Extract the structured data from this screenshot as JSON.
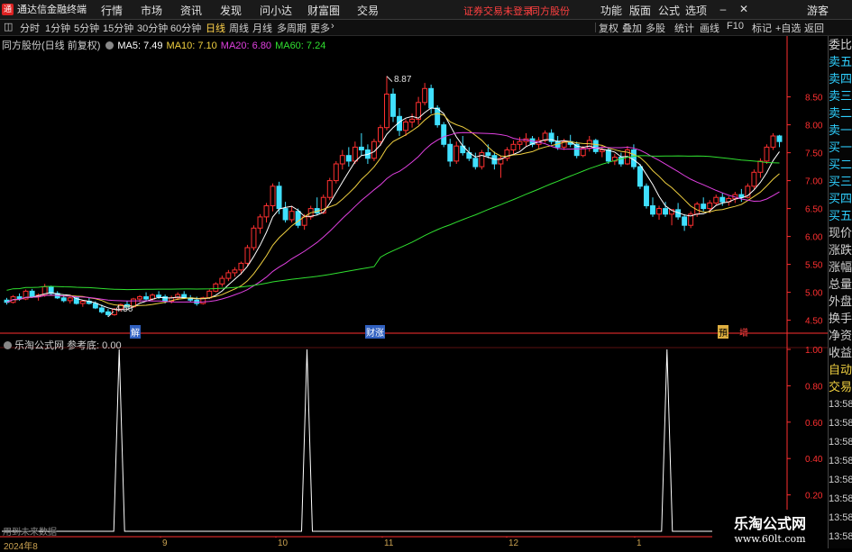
{
  "titlebar": {
    "brand": "通达信金融终端",
    "menus": [
      "行情",
      "市场",
      "资讯",
      "发现",
      "问小达",
      "财富圈",
      "交易"
    ],
    "warning": "证券交易未登录",
    "stock_name": "同方股份",
    "right_menus": [
      "功能",
      "版面",
      "公式",
      "选项"
    ],
    "user": "游客"
  },
  "toolbar": {
    "periods": [
      "分时",
      "1分钟",
      "5分钟",
      "15分钟",
      "30分钟",
      "60分钟",
      "日线",
      "周线",
      "月线",
      "多周期",
      "更多"
    ],
    "active_period": "日线",
    "right_buttons": [
      "复权",
      "叠加",
      "多股",
      "统计",
      "画线",
      "F10",
      "标记",
      "+自选",
      "返回"
    ]
  },
  "legend": {
    "name": "同方股份(日线 前复权)",
    "ma5": "MA5: 7.49",
    "ma10": "MA10: 7.10",
    "ma20": "MA20: 6.80",
    "ma60": "MA60: 7.24"
  },
  "colors": {
    "ma5": "#ffffff",
    "ma10": "#f0d040",
    "ma20": "#e040e0",
    "ma60": "#30e030",
    "up": "#ff3030",
    "down": "#40e0ff",
    "axis": "#ff3030"
  },
  "annotations": {
    "high": "8.87",
    "low": "4.56",
    "marker_jie": "解",
    "marker_caizhang": "财涨",
    "marker_jiang": "預",
    "marker_zeng": "增"
  },
  "sub": {
    "title": "乐淘公式网",
    "indicator": "参考底: 0.00",
    "no_future": "用到未来数据"
  },
  "right_panel": {
    "quote_labels": [
      "委比",
      "卖五",
      "卖四",
      "卖三",
      "卖二",
      "卖一",
      "买一",
      "买二",
      "买三",
      "买四",
      "买五",
      "现价",
      "涨跌",
      "涨幅",
      "总量",
      "外盘",
      "换手",
      "净资",
      "收益"
    ],
    "auto_labels": [
      "自动",
      "交易"
    ],
    "times": [
      "13:58",
      "13:58",
      "13:58",
      "13:58",
      "13:58",
      "13:58",
      "13:58",
      "13:58",
      "13:58"
    ]
  },
  "price_axis": [
    "8.50",
    "8.00",
    "7.50",
    "7.00",
    "6.50",
    "6.00",
    "5.50",
    "5.00",
    "4.50"
  ],
  "sub_axis": [
    "1.00",
    "0.80",
    "0.60",
    "0.40",
    "0.20"
  ],
  "date_labels": [
    "2024年8",
    "9",
    "10",
    "11",
    "12",
    "1"
  ],
  "watermark": {
    "line1": "乐淘公式网",
    "line2": "www.60lt.com"
  },
  "chart_data": [
    {
      "type": "candlestick",
      "title": "同方股份(日线 前复权)",
      "ylim": [
        4.3,
        9.3
      ],
      "yticks": [
        4.5,
        5.0,
        5.5,
        6.0,
        6.5,
        7.0,
        7.5,
        8.0,
        8.5
      ],
      "x_labels": [
        "2024年8",
        "9",
        "10",
        "11",
        "12",
        "1"
      ],
      "candles": [
        [
          4.86,
          4.9,
          4.78,
          4.82
        ],
        [
          4.82,
          4.95,
          4.8,
          4.92
        ],
        [
          4.92,
          4.98,
          4.85,
          4.88
        ],
        [
          4.88,
          5.05,
          4.86,
          5.02
        ],
        [
          5.02,
          5.06,
          4.9,
          4.92
        ],
        [
          4.92,
          4.98,
          4.85,
          4.95
        ],
        [
          4.95,
          5.15,
          4.92,
          5.1
        ],
        [
          5.1,
          5.12,
          4.95,
          4.98
        ],
        [
          4.98,
          5.02,
          4.88,
          4.9
        ],
        [
          4.9,
          4.95,
          4.82,
          4.85
        ],
        [
          4.85,
          4.92,
          4.8,
          4.9
        ],
        [
          4.9,
          4.92,
          4.78,
          4.8
        ],
        [
          4.8,
          4.86,
          4.74,
          4.84
        ],
        [
          4.84,
          4.9,
          4.78,
          4.8
        ],
        [
          4.8,
          4.84,
          4.7,
          4.72
        ],
        [
          4.72,
          4.78,
          4.62,
          4.65
        ],
        [
          4.65,
          4.7,
          4.56,
          4.6
        ],
        [
          4.6,
          4.72,
          4.58,
          4.7
        ],
        [
          4.7,
          4.8,
          4.66,
          4.78
        ],
        [
          4.78,
          4.85,
          4.72,
          4.74
        ],
        [
          4.74,
          4.9,
          4.72,
          4.88
        ],
        [
          4.88,
          4.95,
          4.82,
          4.92
        ],
        [
          4.92,
          5.0,
          4.85,
          4.88
        ],
        [
          4.88,
          4.98,
          4.84,
          4.95
        ],
        [
          4.95,
          5.02,
          4.88,
          4.92
        ],
        [
          4.92,
          4.96,
          4.8,
          4.84
        ],
        [
          4.84,
          4.94,
          4.8,
          4.9
        ],
        [
          4.9,
          5.0,
          4.86,
          4.96
        ],
        [
          4.96,
          5.02,
          4.88,
          4.9
        ],
        [
          4.9,
          4.95,
          4.82,
          4.86
        ],
        [
          4.86,
          4.92,
          4.76,
          4.8
        ],
        [
          4.8,
          4.92,
          4.78,
          4.9
        ],
        [
          4.9,
          5.05,
          4.88,
          5.02
        ],
        [
          5.02,
          5.18,
          5.0,
          5.15
        ],
        [
          5.15,
          5.3,
          5.1,
          5.25
        ],
        [
          5.25,
          5.4,
          5.2,
          5.35
        ],
        [
          5.35,
          5.45,
          5.28,
          5.4
        ],
        [
          5.4,
          5.55,
          5.32,
          5.52
        ],
        [
          5.52,
          5.85,
          5.48,
          5.8
        ],
        [
          5.8,
          6.2,
          5.75,
          6.15
        ],
        [
          6.15,
          6.4,
          6.05,
          6.35
        ],
        [
          6.35,
          6.6,
          6.25,
          6.55
        ],
        [
          6.55,
          6.95,
          6.45,
          6.9
        ],
        [
          6.9,
          6.98,
          6.4,
          6.5
        ],
        [
          6.5,
          6.62,
          6.25,
          6.3
        ],
        [
          6.3,
          6.55,
          6.25,
          6.45
        ],
        [
          6.45,
          6.5,
          6.15,
          6.2
        ],
        [
          6.2,
          6.4,
          6.12,
          6.35
        ],
        [
          6.35,
          6.55,
          6.3,
          6.5
        ],
        [
          6.5,
          6.7,
          6.38,
          6.42
        ],
        [
          6.42,
          6.75,
          6.4,
          6.7
        ],
        [
          6.7,
          7.05,
          6.65,
          7.0
        ],
        [
          7.0,
          7.35,
          6.95,
          7.3
        ],
        [
          7.3,
          7.55,
          7.2,
          7.45
        ],
        [
          7.45,
          7.6,
          7.25,
          7.35
        ],
        [
          7.35,
          7.7,
          7.3,
          7.6
        ],
        [
          7.6,
          7.85,
          7.45,
          7.55
        ],
        [
          7.55,
          7.65,
          7.3,
          7.4
        ],
        [
          7.4,
          7.75,
          7.35,
          7.7
        ],
        [
          7.7,
          8.0,
          7.62,
          7.95
        ],
        [
          7.95,
          8.87,
          7.9,
          8.55
        ],
        [
          8.55,
          8.65,
          8.05,
          8.15
        ],
        [
          8.15,
          8.3,
          7.8,
          7.9
        ],
        [
          7.9,
          8.1,
          7.8,
          8.05
        ],
        [
          8.05,
          8.2,
          7.95,
          8.1
        ],
        [
          8.1,
          8.5,
          8.0,
          8.4
        ],
        [
          8.4,
          8.75,
          8.35,
          8.65
        ],
        [
          8.65,
          8.72,
          8.2,
          8.3
        ],
        [
          8.3,
          8.35,
          7.95,
          8.0
        ],
        [
          8.0,
          8.05,
          7.6,
          7.65
        ],
        [
          7.65,
          7.75,
          7.25,
          7.35
        ],
        [
          7.35,
          7.7,
          7.3,
          7.62
        ],
        [
          7.62,
          7.8,
          7.45,
          7.5
        ],
        [
          7.5,
          7.6,
          7.35,
          7.4
        ],
        [
          7.4,
          7.5,
          7.2,
          7.25
        ],
        [
          7.25,
          7.55,
          7.2,
          7.5
        ],
        [
          7.5,
          7.65,
          7.4,
          7.45
        ],
        [
          7.45,
          7.52,
          7.2,
          7.3
        ],
        [
          7.3,
          7.45,
          7.05,
          7.4
        ],
        [
          7.4,
          7.6,
          7.35,
          7.55
        ],
        [
          7.55,
          7.72,
          7.48,
          7.65
        ],
        [
          7.65,
          7.78,
          7.55,
          7.7
        ],
        [
          7.7,
          7.85,
          7.62,
          7.75
        ],
        [
          7.75,
          7.8,
          7.6,
          7.65
        ],
        [
          7.65,
          7.78,
          7.58,
          7.72
        ],
        [
          7.72,
          7.9,
          7.68,
          7.85
        ],
        [
          7.85,
          7.92,
          7.65,
          7.7
        ],
        [
          7.7,
          7.8,
          7.55,
          7.6
        ],
        [
          7.6,
          7.75,
          7.55,
          7.7
        ],
        [
          7.7,
          7.82,
          7.6,
          7.65
        ],
        [
          7.65,
          7.7,
          7.4,
          7.45
        ],
        [
          7.45,
          7.62,
          7.42,
          7.58
        ],
        [
          7.58,
          7.8,
          7.52,
          7.72
        ],
        [
          7.72,
          7.75,
          7.48,
          7.52
        ],
        [
          7.52,
          7.62,
          7.42,
          7.55
        ],
        [
          7.55,
          7.6,
          7.3,
          7.35
        ],
        [
          7.35,
          7.48,
          7.28,
          7.42
        ],
        [
          7.42,
          7.5,
          7.25,
          7.3
        ],
        [
          7.3,
          7.62,
          7.28,
          7.55
        ],
        [
          7.55,
          7.65,
          7.2,
          7.25
        ],
        [
          7.25,
          7.3,
          6.85,
          6.9
        ],
        [
          6.9,
          6.95,
          6.5,
          6.55
        ],
        [
          6.55,
          6.7,
          6.35,
          6.4
        ],
        [
          6.4,
          6.55,
          6.3,
          6.5
        ],
        [
          6.5,
          6.62,
          6.35,
          6.4
        ],
        [
          6.4,
          6.48,
          6.2,
          6.48
        ],
        [
          6.48,
          6.6,
          6.3,
          6.35
        ],
        [
          6.35,
          6.4,
          6.1,
          6.2
        ],
        [
          6.2,
          6.45,
          6.15,
          6.4
        ],
        [
          6.4,
          6.62,
          6.35,
          6.58
        ],
        [
          6.58,
          6.7,
          6.45,
          6.5
        ],
        [
          6.5,
          6.65,
          6.42,
          6.6
        ],
        [
          6.6,
          6.75,
          6.55,
          6.7
        ],
        [
          6.7,
          6.78,
          6.55,
          6.62
        ],
        [
          6.62,
          6.72,
          6.55,
          6.68
        ],
        [
          6.68,
          6.8,
          6.6,
          6.75
        ],
        [
          6.75,
          6.85,
          6.62,
          6.7
        ],
        [
          6.7,
          6.95,
          6.68,
          6.9
        ],
        [
          6.9,
          7.2,
          6.85,
          7.15
        ],
        [
          7.15,
          7.4,
          7.05,
          7.35
        ],
        [
          7.35,
          7.65,
          7.3,
          7.6
        ],
        [
          7.6,
          7.85,
          7.55,
          7.8
        ],
        [
          7.8,
          7.82,
          7.6,
          7.7
        ]
      ],
      "series": [
        {
          "name": "MA5",
          "color": "#ffffff"
        },
        {
          "name": "MA10",
          "color": "#f0d040"
        },
        {
          "name": "MA20",
          "color": "#e040e0"
        },
        {
          "name": "MA60",
          "color": "#30e030"
        }
      ],
      "high_label": "8.87",
      "low_label": "4.56"
    },
    {
      "type": "line",
      "title": "乐淘公式网 参考底",
      "ylim": [
        0,
        1.0
      ],
      "yticks": [
        1.0,
        0.8,
        0.6,
        0.4,
        0.2
      ],
      "spikes": [
        {
          "index": 30,
          "value": 1.0
        },
        {
          "index": 78,
          "value": 1.0
        },
        {
          "index": 170,
          "value": 1.0
        }
      ],
      "n_points": 200
    }
  ]
}
